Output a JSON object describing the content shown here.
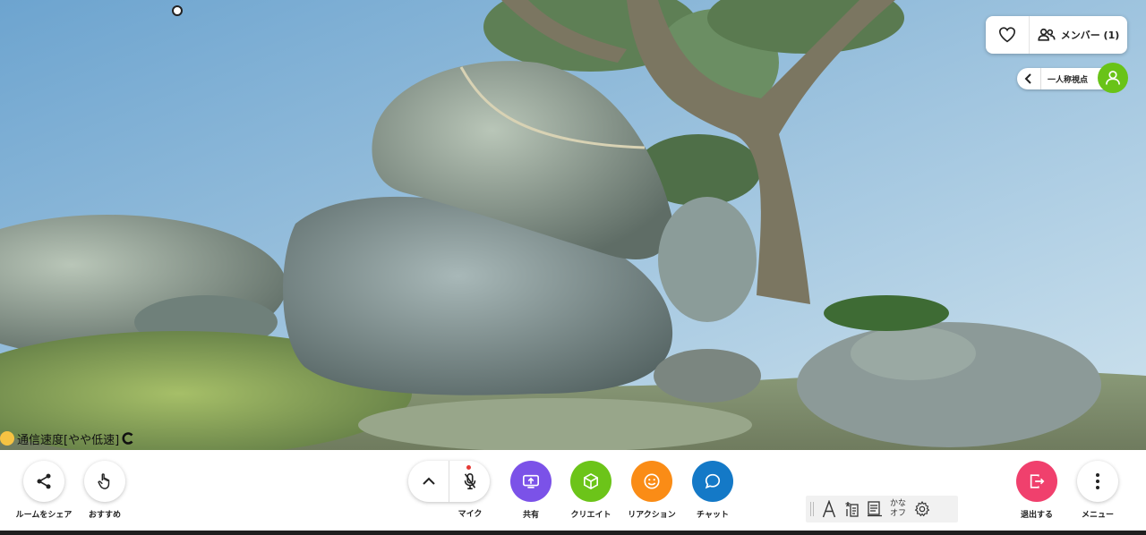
{
  "header": {
    "favorite_icon": "heart-icon",
    "member_icon": "people-icon",
    "member_label": "メンバー (1)",
    "view_label": "一人称視点",
    "avatar_color": "#69c318"
  },
  "status": {
    "network_label": "通信速度[やや低速]",
    "network_color": "#f6c343"
  },
  "toolbar": {
    "share_label": "ルームをシェア",
    "recommend_label": "おすすめ",
    "mic_label": "マイク",
    "screen_share_label": "共有",
    "create_label": "クリエイト",
    "reaction_label": "リアクション",
    "chat_label": "チャット",
    "exit_label": "退出する",
    "menu_label": "メニュー",
    "kana_line1": "かな",
    "kana_line2": "オフ"
  },
  "colors": {
    "screen_share": "#7b52e8",
    "create": "#6cc419",
    "reaction": "#fa8c16",
    "chat": "#1479c7",
    "exit": "#f0406d"
  }
}
